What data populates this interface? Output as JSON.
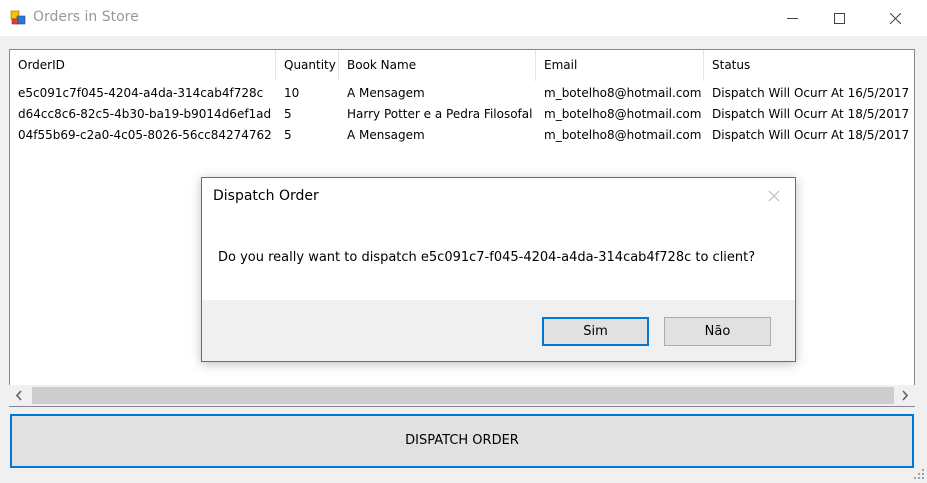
{
  "window": {
    "title": "Orders in Store"
  },
  "listview": {
    "columns": [
      "OrderID",
      "Quantity",
      "Book Name",
      "Email",
      "Status"
    ],
    "rows": [
      [
        "e5c091c7f045-4204-a4da-314cab4f728c",
        "10",
        "A Mensagem",
        "m_botelho8@hotmail.com",
        "Dispatch Will Ocurr At 16/5/2017"
      ],
      [
        "d64cc8c6-82c5-4b30-ba19-b9014d6ef1ad",
        "5",
        "Harry Potter e a Pedra Filosofal",
        "m_botelho8@hotmail.com",
        "Dispatch Will Ocurr At 18/5/2017"
      ],
      [
        "04f55b69-c2a0-4c05-8026-56cc84274762",
        "5",
        "A Mensagem",
        "m_botelho8@hotmail.com",
        "Dispatch Will Ocurr At 18/5/2017"
      ]
    ]
  },
  "dispatch_button": {
    "label": "DISPATCH ORDER"
  },
  "dialog": {
    "title": "Dispatch Order",
    "message": "Do you really want to dispatch e5c091c7-f045-4204-a4da-314cab4f728c to client?",
    "yes_label": "Sim",
    "no_label": "Não"
  },
  "colors": {
    "accent": "#0078d7",
    "dialog_border": "#2b79d0"
  },
  "icons": [
    "app-icon",
    "minimize-icon",
    "maximize-icon",
    "close-icon",
    "scroll-left-icon",
    "scroll-right-icon",
    "dialog-close-icon",
    "resize-grip-icon"
  ]
}
